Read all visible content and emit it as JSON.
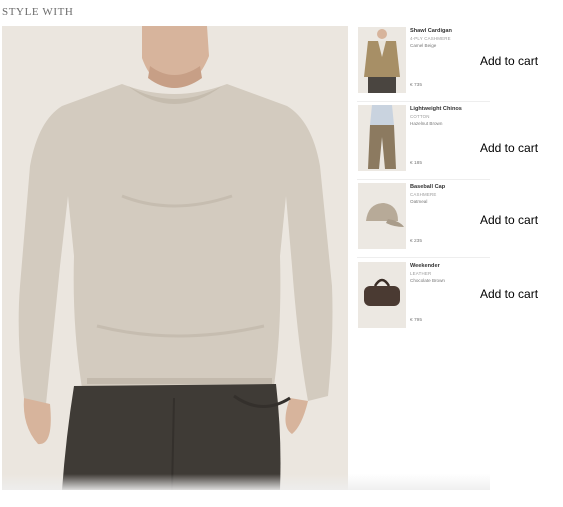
{
  "section": {
    "title": "STYLE WITH"
  },
  "products": [
    {
      "name": "Shawl Cardigan",
      "material": "4-PLY CASHMERE",
      "color": "Camel Beige",
      "price": "€ 735"
    },
    {
      "name": "Lightweight Chinos",
      "material": "COTTON",
      "color": "Hazelnut Brown",
      "price": "€ 185"
    },
    {
      "name": "Baseball Cap",
      "material": "CASHMERE",
      "color": "Oatmeal",
      "price": "€ 235"
    },
    {
      "name": "Weekender",
      "material": "LEATHER",
      "color": "Chocolate Brown",
      "price": "€ 795"
    }
  ],
  "actions": {
    "add_to_cart": "Add to cart"
  },
  "colors": {
    "sweater": "#d3cbbf",
    "trousers": "#3f3b36",
    "background": "#ebe6df",
    "bag": "#4a3a32"
  },
  "icons": {
    "hero": "model-wearing-sweater-image"
  }
}
